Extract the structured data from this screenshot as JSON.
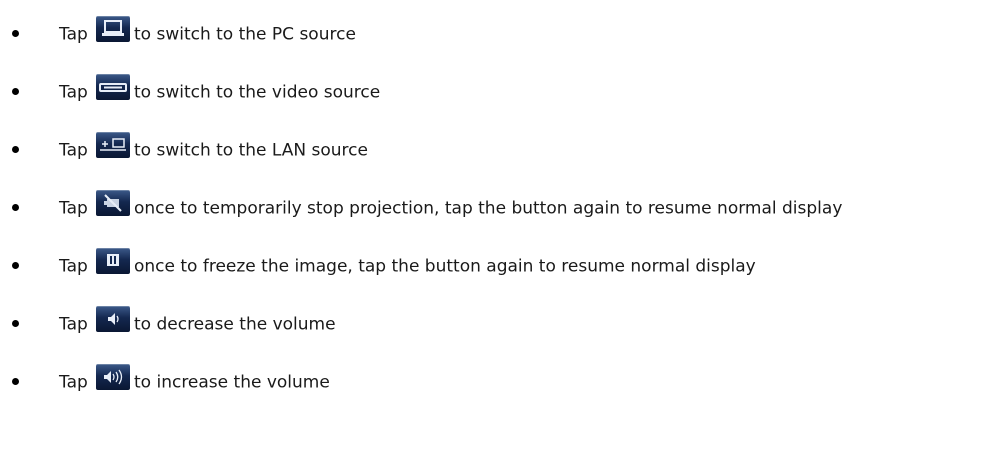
{
  "items": [
    {
      "tap": "Tap",
      "icon": "pc-source-icon",
      "text": "to switch to the PC source"
    },
    {
      "tap": "Tap",
      "icon": "video-source-icon",
      "text": "to switch to the video source"
    },
    {
      "tap": "Tap",
      "icon": "lan-source-icon",
      "text": "to switch to the LAN source"
    },
    {
      "tap": "Tap",
      "icon": "blank-screen-icon",
      "text": "once to temporarily stop projection, tap the button again to resume normal display"
    },
    {
      "tap": "Tap",
      "icon": "freeze-icon",
      "text": "once to freeze the image, tap the button again to resume normal display"
    },
    {
      "tap": "Tap",
      "icon": "volume-down-icon",
      "text": "to decrease the volume"
    },
    {
      "tap": "Tap",
      "icon": "volume-up-icon",
      "text": "to increase the volume"
    }
  ],
  "colors": {
    "button_top": "#3c5a8a",
    "button_bottom": "#0a1733",
    "text": "#1a1a1a"
  }
}
